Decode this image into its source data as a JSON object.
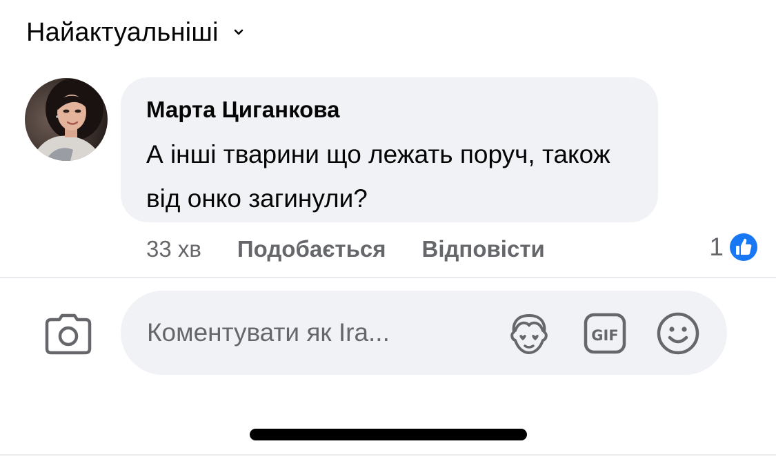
{
  "sort": {
    "label": "Найактуальніші",
    "icon": "chevron-down-icon"
  },
  "comment": {
    "author": "Марта Циганкова",
    "text": "А інші тварини що лежать поруч, також від онко загинули?",
    "time": "33 хв",
    "like_label": "Подобається",
    "reply_label": "Відповісти",
    "reaction_count": "1",
    "reaction_icon": "like-icon"
  },
  "composer": {
    "placeholder": "Коментувати як Ira...",
    "camera_icon": "camera-icon",
    "avatar_sticker_icon": "avatar-sticker-icon",
    "gif_icon": "gif-icon",
    "gif_label": "GIF",
    "emoji_icon": "emoji-icon"
  },
  "colors": {
    "text": "#050505",
    "secondary_text": "#65676b",
    "bubble": "#f0f2f5",
    "like_blue": "#1877f2"
  }
}
